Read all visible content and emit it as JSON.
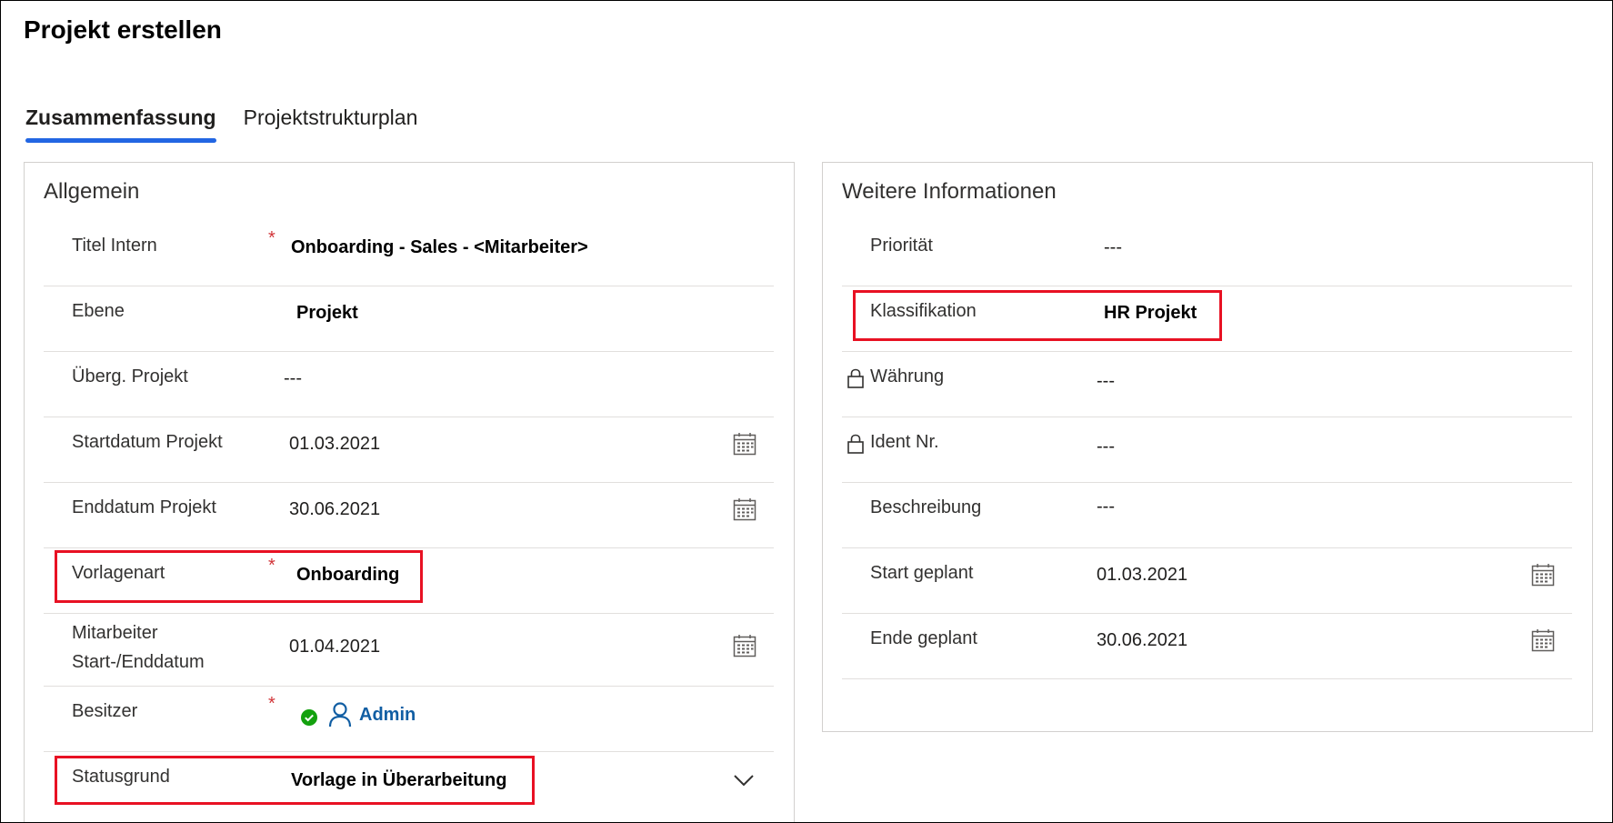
{
  "page": {
    "title": "Projekt erstellen"
  },
  "tabs": [
    {
      "label": "Zusammenfassung",
      "active": true
    },
    {
      "label": "Projektstrukturplan",
      "active": false
    }
  ],
  "general": {
    "title": "Allgemein",
    "fields": {
      "titel_intern": {
        "label": "Titel Intern",
        "value": "Onboarding - Sales - <Mitarbeiter>",
        "required": true
      },
      "ebene": {
        "label": "Ebene",
        "value": "Projekt"
      },
      "ueberg_projekt": {
        "label": "Überg. Projekt",
        "value": "---"
      },
      "startdatum": {
        "label": "Startdatum Projekt",
        "value": "01.03.2021"
      },
      "enddatum": {
        "label": "Enddatum Projekt",
        "value": "30.06.2021"
      },
      "vorlagenart": {
        "label": "Vorlagenart",
        "value": "Onboarding",
        "required": true
      },
      "mitarbeiter": {
        "label_line1": "Mitarbeiter",
        "label_line2": "Start-/Enddatum",
        "value": "01.04.2021"
      },
      "besitzer": {
        "label": "Besitzer",
        "value": "Admin",
        "required": true
      },
      "statusgrund": {
        "label": "Statusgrund",
        "value": "Vorlage in Überarbeitung"
      }
    }
  },
  "more_info": {
    "title": "Weitere Informationen",
    "fields": {
      "prioritaet": {
        "label": "Priorität",
        "value": "---"
      },
      "klassifikation": {
        "label": "Klassifikation",
        "value": "HR Projekt"
      },
      "waehrung": {
        "label": "Währung",
        "value": "---",
        "locked": true
      },
      "ident_nr": {
        "label": "Ident Nr.",
        "value": "---",
        "locked": true
      },
      "beschreibung": {
        "label": "Beschreibung",
        "value": "---"
      },
      "start_geplant": {
        "label": "Start geplant",
        "value": "01.03.2021"
      },
      "ende_geplant": {
        "label": "Ende geplant",
        "value": "30.06.2021"
      }
    }
  },
  "colors": {
    "accent": "#2266e3",
    "required": "#d13438",
    "link": "#115ea3",
    "highlight": "#e81123",
    "success": "#13a10e"
  },
  "icons": {
    "calendar": "calendar-icon",
    "chevron": "chevron-down-icon",
    "lock": "lock-icon",
    "status": "check-circle-icon",
    "person": "person-icon"
  }
}
